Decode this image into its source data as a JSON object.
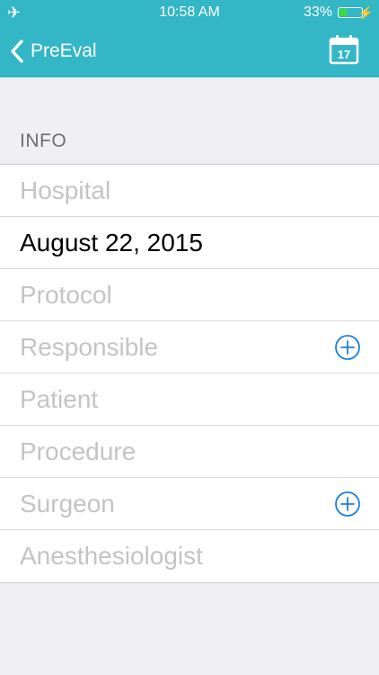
{
  "status_bar": {
    "time": "10:58 AM",
    "battery_percent": "33%",
    "battery_level": 0.33,
    "colors": {
      "battery_fill": "#3ddc3d"
    }
  },
  "nav": {
    "back_label": "PreEval",
    "calendar_day": "17",
    "colors": {
      "bar": "#33b6c6"
    }
  },
  "section": {
    "title": "INFO",
    "rows": [
      {
        "label": "Hospital",
        "has_add": false,
        "filled": false
      },
      {
        "label": "August 22, 2015",
        "has_add": false,
        "filled": true
      },
      {
        "label": "Protocol",
        "has_add": false,
        "filled": false
      },
      {
        "label": "Responsible",
        "has_add": true,
        "filled": false
      },
      {
        "label": "Patient",
        "has_add": false,
        "filled": false
      },
      {
        "label": "Procedure",
        "has_add": false,
        "filled": false
      },
      {
        "label": "Surgeon",
        "has_add": true,
        "filled": false
      },
      {
        "label": "Anesthesiologist",
        "has_add": false,
        "filled": false
      }
    ]
  },
  "icons": {
    "add": "plus-circle-icon",
    "back": "chevron-left-icon",
    "calendar": "calendar-icon",
    "airplane": "airplane-icon",
    "charging": "bolt-icon"
  }
}
